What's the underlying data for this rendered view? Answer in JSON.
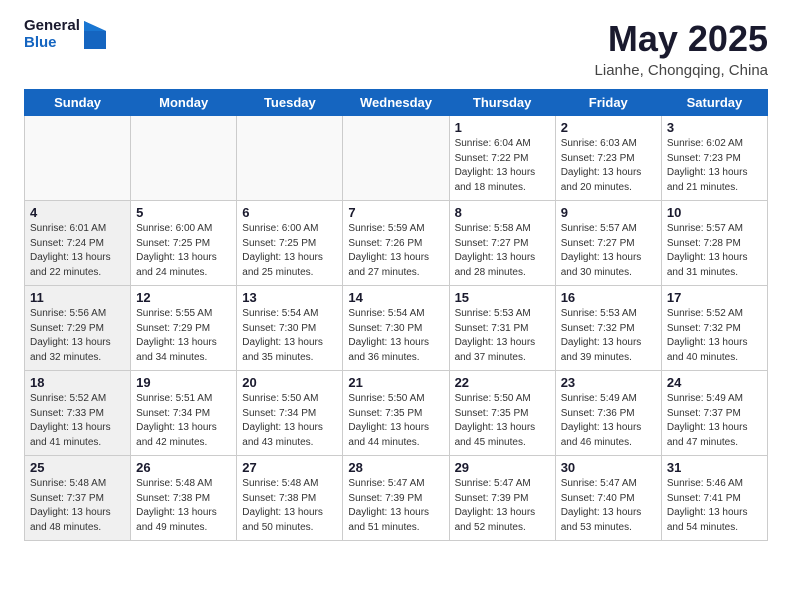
{
  "header": {
    "logo_general": "General",
    "logo_blue": "Blue",
    "month_year": "May 2025",
    "location": "Lianhe, Chongqing, China"
  },
  "days_of_week": [
    "Sunday",
    "Monday",
    "Tuesday",
    "Wednesday",
    "Thursday",
    "Friday",
    "Saturday"
  ],
  "weeks": [
    [
      {
        "num": "",
        "empty": true
      },
      {
        "num": "",
        "empty": true
      },
      {
        "num": "",
        "empty": true
      },
      {
        "num": "",
        "empty": true
      },
      {
        "num": "1",
        "info": "Sunrise: 6:04 AM\nSunset: 7:22 PM\nDaylight: 13 hours\nand 18 minutes."
      },
      {
        "num": "2",
        "info": "Sunrise: 6:03 AM\nSunset: 7:23 PM\nDaylight: 13 hours\nand 20 minutes."
      },
      {
        "num": "3",
        "info": "Sunrise: 6:02 AM\nSunset: 7:23 PM\nDaylight: 13 hours\nand 21 minutes."
      }
    ],
    [
      {
        "num": "4",
        "info": "Sunrise: 6:01 AM\nSunset: 7:24 PM\nDaylight: 13 hours\nand 22 minutes.",
        "shaded": true
      },
      {
        "num": "5",
        "info": "Sunrise: 6:00 AM\nSunset: 7:25 PM\nDaylight: 13 hours\nand 24 minutes."
      },
      {
        "num": "6",
        "info": "Sunrise: 6:00 AM\nSunset: 7:25 PM\nDaylight: 13 hours\nand 25 minutes."
      },
      {
        "num": "7",
        "info": "Sunrise: 5:59 AM\nSunset: 7:26 PM\nDaylight: 13 hours\nand 27 minutes."
      },
      {
        "num": "8",
        "info": "Sunrise: 5:58 AM\nSunset: 7:27 PM\nDaylight: 13 hours\nand 28 minutes."
      },
      {
        "num": "9",
        "info": "Sunrise: 5:57 AM\nSunset: 7:27 PM\nDaylight: 13 hours\nand 30 minutes."
      },
      {
        "num": "10",
        "info": "Sunrise: 5:57 AM\nSunset: 7:28 PM\nDaylight: 13 hours\nand 31 minutes."
      }
    ],
    [
      {
        "num": "11",
        "info": "Sunrise: 5:56 AM\nSunset: 7:29 PM\nDaylight: 13 hours\nand 32 minutes.",
        "shaded": true
      },
      {
        "num": "12",
        "info": "Sunrise: 5:55 AM\nSunset: 7:29 PM\nDaylight: 13 hours\nand 34 minutes."
      },
      {
        "num": "13",
        "info": "Sunrise: 5:54 AM\nSunset: 7:30 PM\nDaylight: 13 hours\nand 35 minutes."
      },
      {
        "num": "14",
        "info": "Sunrise: 5:54 AM\nSunset: 7:30 PM\nDaylight: 13 hours\nand 36 minutes."
      },
      {
        "num": "15",
        "info": "Sunrise: 5:53 AM\nSunset: 7:31 PM\nDaylight: 13 hours\nand 37 minutes."
      },
      {
        "num": "16",
        "info": "Sunrise: 5:53 AM\nSunset: 7:32 PM\nDaylight: 13 hours\nand 39 minutes."
      },
      {
        "num": "17",
        "info": "Sunrise: 5:52 AM\nSunset: 7:32 PM\nDaylight: 13 hours\nand 40 minutes."
      }
    ],
    [
      {
        "num": "18",
        "info": "Sunrise: 5:52 AM\nSunset: 7:33 PM\nDaylight: 13 hours\nand 41 minutes.",
        "shaded": true
      },
      {
        "num": "19",
        "info": "Sunrise: 5:51 AM\nSunset: 7:34 PM\nDaylight: 13 hours\nand 42 minutes."
      },
      {
        "num": "20",
        "info": "Sunrise: 5:50 AM\nSunset: 7:34 PM\nDaylight: 13 hours\nand 43 minutes."
      },
      {
        "num": "21",
        "info": "Sunrise: 5:50 AM\nSunset: 7:35 PM\nDaylight: 13 hours\nand 44 minutes."
      },
      {
        "num": "22",
        "info": "Sunrise: 5:50 AM\nSunset: 7:35 PM\nDaylight: 13 hours\nand 45 minutes."
      },
      {
        "num": "23",
        "info": "Sunrise: 5:49 AM\nSunset: 7:36 PM\nDaylight: 13 hours\nand 46 minutes."
      },
      {
        "num": "24",
        "info": "Sunrise: 5:49 AM\nSunset: 7:37 PM\nDaylight: 13 hours\nand 47 minutes."
      }
    ],
    [
      {
        "num": "25",
        "info": "Sunrise: 5:48 AM\nSunset: 7:37 PM\nDaylight: 13 hours\nand 48 minutes.",
        "shaded": true
      },
      {
        "num": "26",
        "info": "Sunrise: 5:48 AM\nSunset: 7:38 PM\nDaylight: 13 hours\nand 49 minutes."
      },
      {
        "num": "27",
        "info": "Sunrise: 5:48 AM\nSunset: 7:38 PM\nDaylight: 13 hours\nand 50 minutes."
      },
      {
        "num": "28",
        "info": "Sunrise: 5:47 AM\nSunset: 7:39 PM\nDaylight: 13 hours\nand 51 minutes."
      },
      {
        "num": "29",
        "info": "Sunrise: 5:47 AM\nSunset: 7:39 PM\nDaylight: 13 hours\nand 52 minutes."
      },
      {
        "num": "30",
        "info": "Sunrise: 5:47 AM\nSunset: 7:40 PM\nDaylight: 13 hours\nand 53 minutes."
      },
      {
        "num": "31",
        "info": "Sunrise: 5:46 AM\nSunset: 7:41 PM\nDaylight: 13 hours\nand 54 minutes."
      }
    ]
  ]
}
